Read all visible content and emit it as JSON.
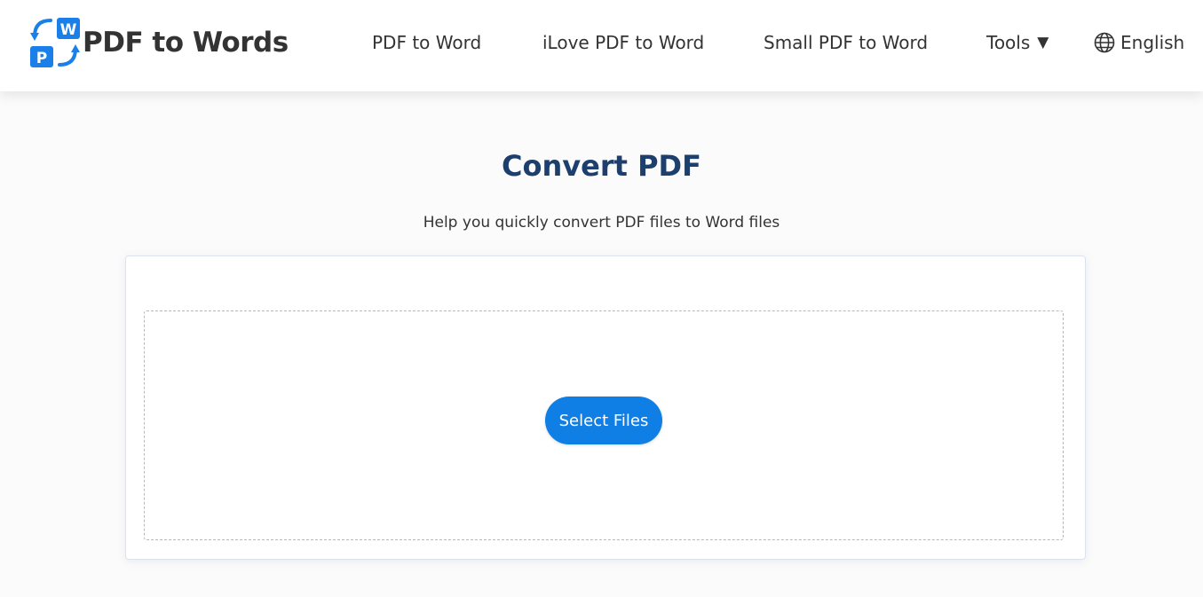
{
  "header": {
    "brand": {
      "name": "PDF to Words",
      "logo_letters": [
        "W",
        "P"
      ],
      "logo_color": "#1a7fe8"
    },
    "nav": [
      {
        "label": "PDF to Word"
      },
      {
        "label": "iLove PDF to Word"
      },
      {
        "label": "Small PDF to Word"
      }
    ],
    "tools": {
      "label": "Tools",
      "caret": "▼"
    },
    "language": {
      "label": "English",
      "icon": "globe-icon"
    }
  },
  "main": {
    "title": "Convert PDF",
    "subtitle": "Help you quickly convert PDF files to Word files",
    "upload": {
      "button_label": "Select Files",
      "button_color": "#0f7fe6"
    }
  },
  "colors": {
    "title": "#1d3f6e",
    "text": "#333333",
    "accent": "#0f7fe6"
  }
}
